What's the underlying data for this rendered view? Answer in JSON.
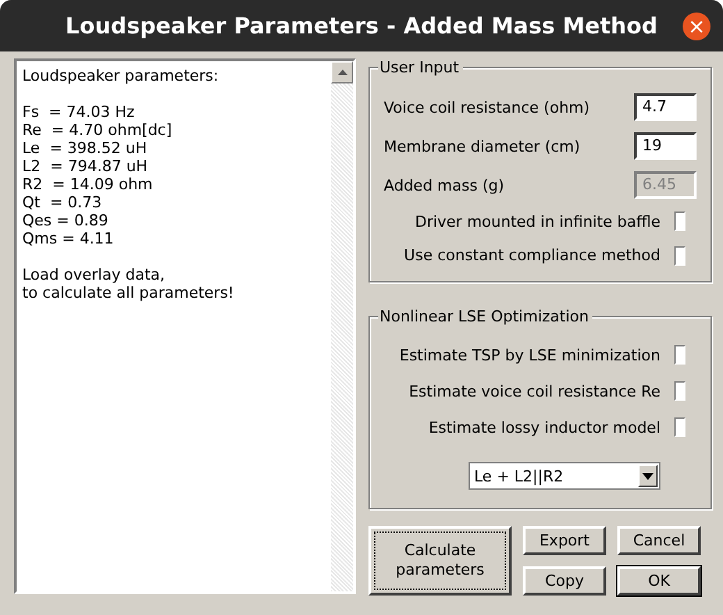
{
  "window": {
    "title": "Loudspeaker Parameters - Added Mass Method",
    "close": "×"
  },
  "output": {
    "blocks": [
      [
        "Loudspeaker parameters:"
      ],
      [
        "Fs  = 74.03 Hz",
        "Re  = 4.70 ohm[dc]",
        "Le  = 398.52 uH",
        "L2  = 794.87 uH",
        "R2  = 14.09 ohm",
        "Qt  = 0.73",
        "Qes = 0.89",
        "Qms = 4.11"
      ],
      [
        "Load overlay data,",
        "to calculate all parameters!"
      ]
    ]
  },
  "user_input": {
    "title": "User Input",
    "fields": [
      {
        "label": "Voice coil resistance (ohm)",
        "value": "4.7",
        "disabled": false
      },
      {
        "label": "Membrane diameter (cm)",
        "value": "19",
        "disabled": false
      },
      {
        "label": "Added mass (g)",
        "value": "6.45",
        "disabled": true
      }
    ],
    "options": [
      {
        "label": "Driver mounted in infinite baffle",
        "checked": false
      },
      {
        "label": "Use constant compliance method",
        "checked": false
      }
    ]
  },
  "optimization": {
    "title": "Nonlinear LSE Optimization",
    "options": [
      {
        "label": "Estimate TSP by LSE minimization",
        "checked": false
      },
      {
        "label": "Estimate voice coil resistance Re",
        "checked": false
      },
      {
        "label": "Estimate lossy inductor model",
        "checked": false
      }
    ],
    "model": {
      "value": "Le + L2||R2"
    }
  },
  "buttons": {
    "calculate": {
      "label": "Calculate parameters",
      "focused": true
    },
    "grid": [
      {
        "label": "Export",
        "default": false
      },
      {
        "label": "Cancel",
        "default": false
      },
      {
        "label": "Copy",
        "default": false
      },
      {
        "label": "OK",
        "default": true
      }
    ]
  }
}
